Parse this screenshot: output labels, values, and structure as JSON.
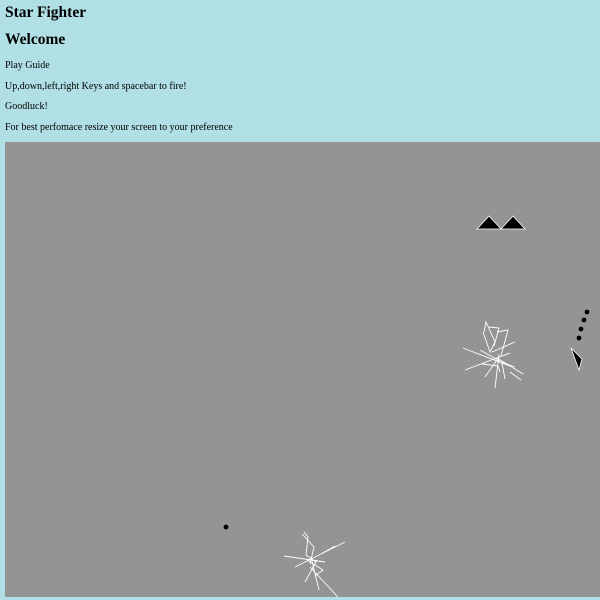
{
  "page": {
    "title": "Star Fighter",
    "welcome": "Welcome",
    "guide_heading": "Play Guide",
    "instructions": "Up,down,left,right Keys and spacebar to fire!",
    "goodluck": "Goodluck!",
    "tip": "For best perfomace resize your screen to your preference"
  },
  "colors": {
    "page_background": "#b0dfe5",
    "game_background": "#949494",
    "sprite_fill": "#000000",
    "debris_stroke": "#ffffff"
  },
  "game": {
    "lives_remaining": 2,
    "player_ship": "arrow-ship",
    "enemy_bullets_visible": 6,
    "explosions_visible": 2
  }
}
